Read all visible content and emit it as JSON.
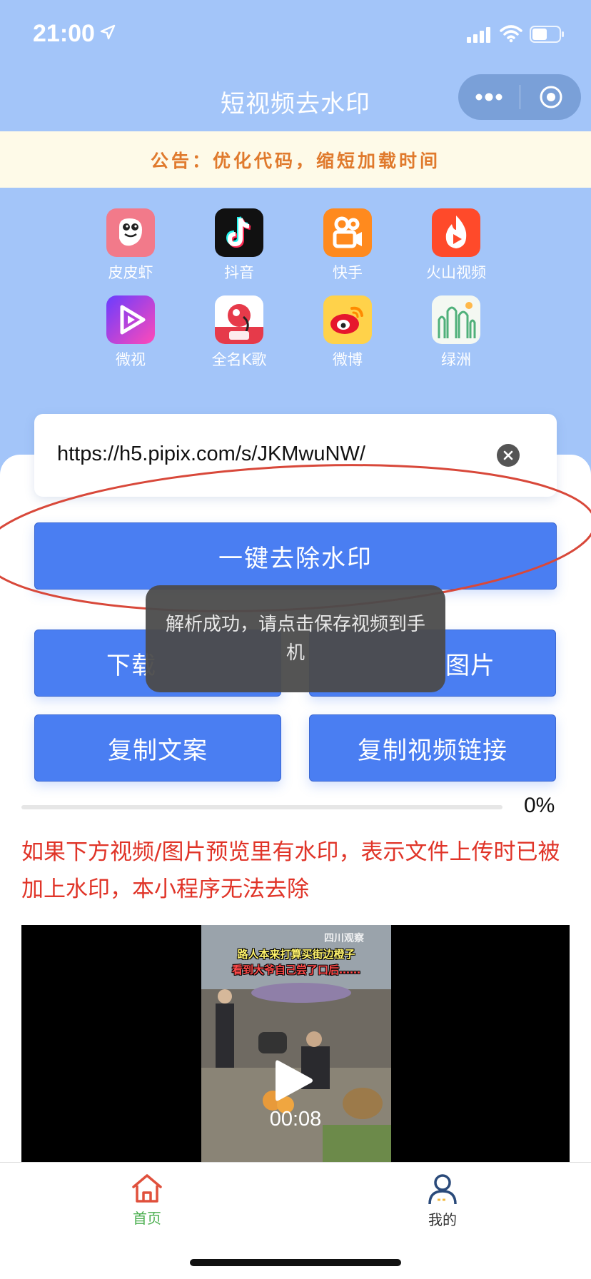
{
  "status_bar": {
    "time": "21:00"
  },
  "nav": {
    "title": "短视频去水印"
  },
  "notice": {
    "text": "公告：优化代码，缩短加载时间"
  },
  "apps": [
    {
      "label": "皮皮虾",
      "icon": "pipixia-icon"
    },
    {
      "label": "抖音",
      "icon": "douyin-icon"
    },
    {
      "label": "快手",
      "icon": "kuaishou-icon"
    },
    {
      "label": "火山视频",
      "icon": "huoshan-icon"
    },
    {
      "label": "微视",
      "icon": "weishi-icon"
    },
    {
      "label": "全名K歌",
      "icon": "kge-icon"
    },
    {
      "label": "微博",
      "icon": "weibo-icon"
    },
    {
      "label": "绿洲",
      "icon": "lvzhou-icon"
    }
  ],
  "input": {
    "value": "https://h5.pipix.com/s/JKMwuNW/"
  },
  "buttons": {
    "remove_watermark": "一键去除水印",
    "download_video_visible": "下载",
    "save_images_visible": "图片",
    "copy_text": "复制文案",
    "copy_link": "复制视频链接"
  },
  "toast": {
    "text": "解析成功，请点击保存视频到手机"
  },
  "progress": {
    "value": 0,
    "label": "0%"
  },
  "warning": {
    "text": "如果下方视频/图片预览里有水印，表示文件上传时已被加上水印，本小程序无法去除"
  },
  "video": {
    "caption_line1": "路人本来打算买街边橙子",
    "caption_line2": "看到大爷自己尝了口后……",
    "brand": "四川观察",
    "duration": "00:08"
  },
  "tabs": [
    {
      "label": "首页",
      "icon": "home-icon",
      "color": "#4caf50"
    },
    {
      "label": "我的",
      "icon": "user-icon",
      "color": "#333333"
    }
  ],
  "colors": {
    "primary": "#4a7ef2",
    "header": "#a3c5f9",
    "notice_text": "#e07a2d",
    "warning": "#e03428"
  }
}
